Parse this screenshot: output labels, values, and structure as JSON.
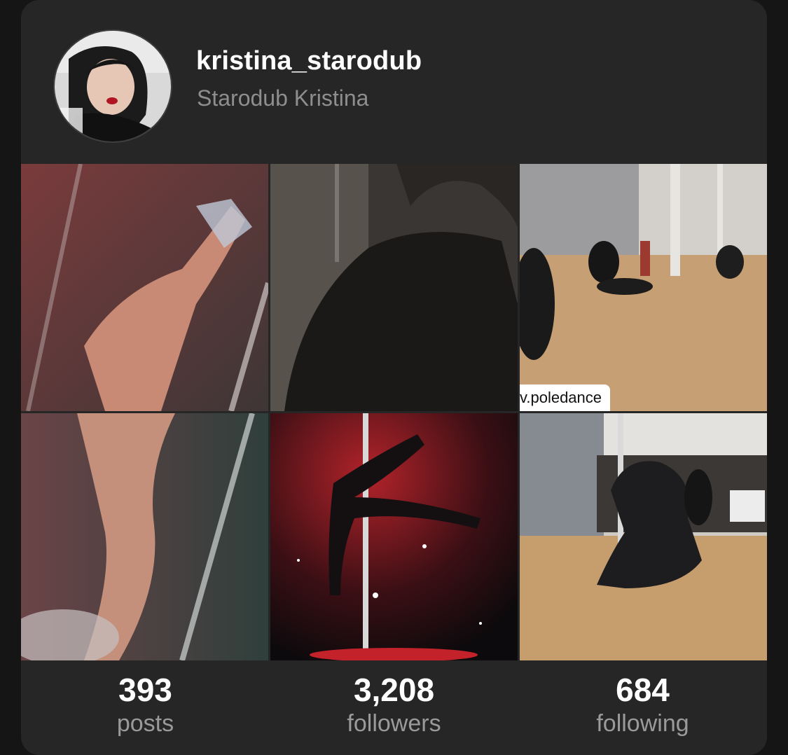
{
  "profile": {
    "username": "kristina_starodub",
    "full_name": "Starodub Kristina",
    "avatar_icon": "profile-photo"
  },
  "posts": [
    {
      "kind": "photo"
    },
    {
      "kind": "photo"
    },
    {
      "kind": "video",
      "caption": "v.poledance"
    },
    {
      "kind": "photo"
    },
    {
      "kind": "photo"
    },
    {
      "kind": "photo"
    }
  ],
  "stats": [
    {
      "value": "393",
      "label": "posts"
    },
    {
      "value": "3,208",
      "label": "followers"
    },
    {
      "value": "684",
      "label": "following"
    }
  ],
  "colors": {
    "card_bg": "#262626",
    "page_bg": "#151515",
    "username": "#ffffff",
    "secondary_text": "#8e8e8e"
  }
}
